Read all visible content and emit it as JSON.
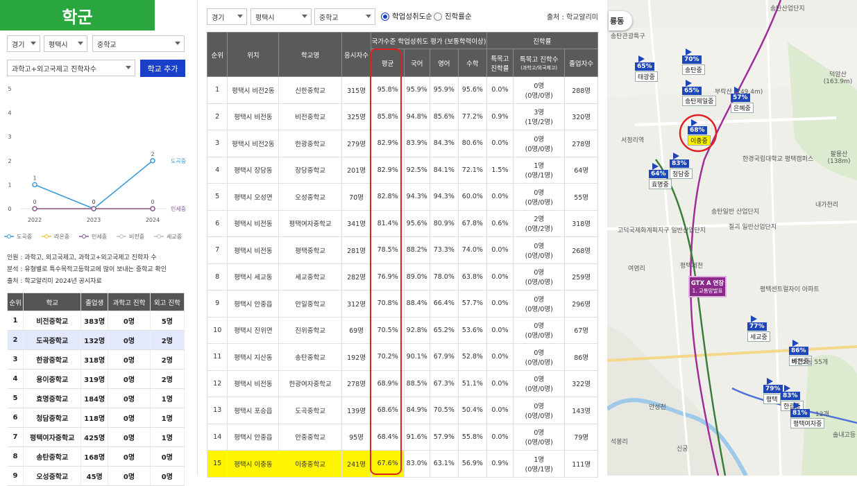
{
  "left": {
    "title": "학군",
    "province": "경기",
    "city": "평택시",
    "school_type": "중학교",
    "criteria": "과학고+외고국제고 진학자수",
    "add_button": "학교 추가",
    "chart_note_1": "인원 : 과학고, 외고국제고, 과학고+외고국제고 진학자 수",
    "chart_note_2": "분석 : 유형별로 특수목적고등학교에 많이 보내는 중학교 확인",
    "chart_note_3": "출처 : 학교알리미 2024년 공시자료",
    "ranking_headers": [
      "순위",
      "학교",
      "졸업생",
      "과학고 진학",
      "외고 진학"
    ],
    "ranking": [
      [
        "1",
        "비전중학교",
        "383명",
        "0명",
        "5명"
      ],
      [
        "2",
        "도곡중학교",
        "132명",
        "0명",
        "2명"
      ],
      [
        "3",
        "한광중학교",
        "318명",
        "0명",
        "2명"
      ],
      [
        "4",
        "용이중학교",
        "319명",
        "0명",
        "2명"
      ],
      [
        "5",
        "효명중학교",
        "184명",
        "0명",
        "1명"
      ],
      [
        "6",
        "청담중학교",
        "118명",
        "0명",
        "1명"
      ],
      [
        "7",
        "평택여자중학교",
        "425명",
        "0명",
        "1명"
      ],
      [
        "8",
        "송탄중학교",
        "168명",
        "0명",
        "0명"
      ],
      [
        "9",
        "오성중학교",
        "45명",
        "0명",
        "0명"
      ]
    ]
  },
  "chart_data": {
    "type": "line",
    "x": [
      "2022",
      "2023",
      "2024"
    ],
    "y_ticks": [
      "0",
      "1",
      "2",
      "3",
      "4",
      "5"
    ],
    "ylim": [
      0,
      5
    ],
    "series": [
      {
        "name": "도곡중",
        "color": "#3a9ad9",
        "values": [
          1,
          0,
          2
        ],
        "labels": [
          "1",
          "0",
          "2"
        ],
        "end_label": "도곡중"
      },
      {
        "name": "라온중",
        "color": "#e8c23a",
        "values": [
          0,
          0,
          0
        ],
        "labels": [
          "0",
          "",
          ""
        ]
      },
      {
        "name": "민세중",
        "color": "#8a5a9a",
        "values": [
          0,
          0,
          0
        ],
        "labels": [
          "",
          "0",
          "0"
        ],
        "end_label": "민세중"
      },
      {
        "name": "비전중",
        "color": "#bbbbbb",
        "values": [],
        "labels": []
      },
      {
        "name": "세교중",
        "color": "#bbbbbb",
        "values": [],
        "labels": []
      }
    ]
  },
  "mid": {
    "province": "경기",
    "city": "평택시",
    "school_type": "중학교",
    "radio_1": "학업성취도순",
    "radio_2": "진학률순",
    "source": "출처 : 학교알리미",
    "h_rank": "순위",
    "h_loc": "위치",
    "h_name": "학교명",
    "h_count": "응시자수",
    "h_group1": "국가수준 학업성취도 평가 (보통학력이상)",
    "h_group2": "진학률",
    "h_avg": "평균",
    "h_kor": "국어",
    "h_eng": "영어",
    "h_math": "수학",
    "h_rate": "특목고 진학률",
    "h_cnt": "특목고 진학수",
    "h_cnt_sub": "(과학고/외국제고)",
    "h_grad": "졸업자수",
    "rows": [
      [
        "1",
        "평택시 비전2동",
        "신한중학교",
        "315명",
        "95.8%",
        "95.9%",
        "95.9%",
        "95.6%",
        "0.0%",
        "0명",
        "(0명/0명)",
        "288명"
      ],
      [
        "2",
        "평택시 비전동",
        "비전중학교",
        "325명",
        "85.8%",
        "94.8%",
        "85.6%",
        "77.2%",
        "0.9%",
        "3명",
        "(1명/2명)",
        "320명"
      ],
      [
        "3",
        "평택시 비전2동",
        "한광중학교",
        "279명",
        "82.9%",
        "83.9%",
        "84.3%",
        "80.6%",
        "0.0%",
        "0명",
        "(0명/0명)",
        "278명"
      ],
      [
        "4",
        "평택시 장당동",
        "장당중학교",
        "201명",
        "82.9%",
        "92.5%",
        "84.1%",
        "72.1%",
        "1.5%",
        "1명",
        "(0명/1명)",
        "64명"
      ],
      [
        "5",
        "평택시 오성면",
        "오성중학교",
        "70명",
        "82.8%",
        "94.3%",
        "94.3%",
        "60.0%",
        "0.0%",
        "0명",
        "(0명/0명)",
        "55명"
      ],
      [
        "6",
        "평택시 비전동",
        "평택여자중학교",
        "341명",
        "81.4%",
        "95.6%",
        "80.9%",
        "67.8%",
        "0.6%",
        "2명",
        "(0명/2명)",
        "318명"
      ],
      [
        "7",
        "평택시 비전동",
        "평택중학교",
        "281명",
        "78.5%",
        "88.2%",
        "73.3%",
        "74.0%",
        "0.0%",
        "0명",
        "(0명/0명)",
        "268명"
      ],
      [
        "8",
        "평택시 세교동",
        "세교중학교",
        "282명",
        "76.9%",
        "89.0%",
        "78.0%",
        "63.8%",
        "0.0%",
        "0명",
        "(0명/0명)",
        "259명"
      ],
      [
        "9",
        "평택시 안중읍",
        "안일중학교",
        "312명",
        "70.8%",
        "88.4%",
        "66.4%",
        "57.7%",
        "0.0%",
        "0명",
        "(0명/0명)",
        "296명"
      ],
      [
        "10",
        "평택시 진위면",
        "진위중학교",
        "69명",
        "70.5%",
        "92.8%",
        "65.2%",
        "53.6%",
        "0.0%",
        "0명",
        "(0명/0명)",
        "67명"
      ],
      [
        "11",
        "평택시 지산동",
        "송탄중학교",
        "192명",
        "70.2%",
        "90.1%",
        "67.9%",
        "52.8%",
        "0.0%",
        "0명",
        "(0명/0명)",
        "86명"
      ],
      [
        "12",
        "평택시 비전동",
        "한광여자중학교",
        "278명",
        "68.9%",
        "88.5%",
        "67.3%",
        "51.1%",
        "0.0%",
        "0명",
        "(0명/0명)",
        "322명"
      ],
      [
        "13",
        "평택시 포승읍",
        "도곡중학교",
        "139명",
        "68.6%",
        "84.9%",
        "70.5%",
        "50.4%",
        "0.0%",
        "0명",
        "(0명/0명)",
        "143명"
      ],
      [
        "14",
        "평택시 안중읍",
        "안중중학교",
        "95명",
        "68.4%",
        "91.6%",
        "57.9%",
        "55.8%",
        "0.0%",
        "0명",
        "(0명/0명)",
        "79명"
      ],
      [
        "15",
        "평택시 이충동",
        "이충중학교",
        "241명",
        "67.6%",
        "83.0%",
        "63.1%",
        "56.9%",
        "0.9%",
        "1명",
        "(0명/1명)",
        "111명"
      ]
    ]
  },
  "map": {
    "tab": "룡동",
    "pins": [
      {
        "pct": "65%",
        "name": "태광중"
      },
      {
        "pct": "70%",
        "name": "송탄중"
      },
      {
        "pct": "65%",
        "name": "송탄제일중"
      },
      {
        "pct": "57%",
        "name": "은혜중"
      },
      {
        "pct": "68%",
        "name": "이충중"
      },
      {
        "pct": "83%",
        "name": "청담중"
      },
      {
        "pct": "64%",
        "name": "효명중"
      },
      {
        "pct": "77%",
        "name": "세교중"
      },
      {
        "pct": "86%",
        "name": "비전중"
      },
      {
        "pct": "79%",
        "name": "평택"
      },
      {
        "pct": "83%",
        "name": "한광중"
      },
      {
        "pct": "81%",
        "name": "평택여자중"
      }
    ],
    "labels": [
      "서정리역",
      "송탄일반 산업단지",
      "고덕국제화계획지구 일반산업단지",
      "칠괴 일반산업단지",
      "내가천리",
      "여염리",
      "한경국립대학교 평택캠퍼스",
      "덕암산 (163.9m)",
      "부락산 (149.4m)",
      "팔용산 (138m)",
      "석봉리",
      "신궁",
      "평택제천",
      "송탄산업단지",
      "안성천",
      "비전2동 55개",
      "12개",
      "솔내고등",
      "송탄관광특구",
      "평택센트럴자이 아파트"
    ],
    "gtx": "GTX A 연장",
    "gtx_sub": "1. 교통망발표"
  }
}
